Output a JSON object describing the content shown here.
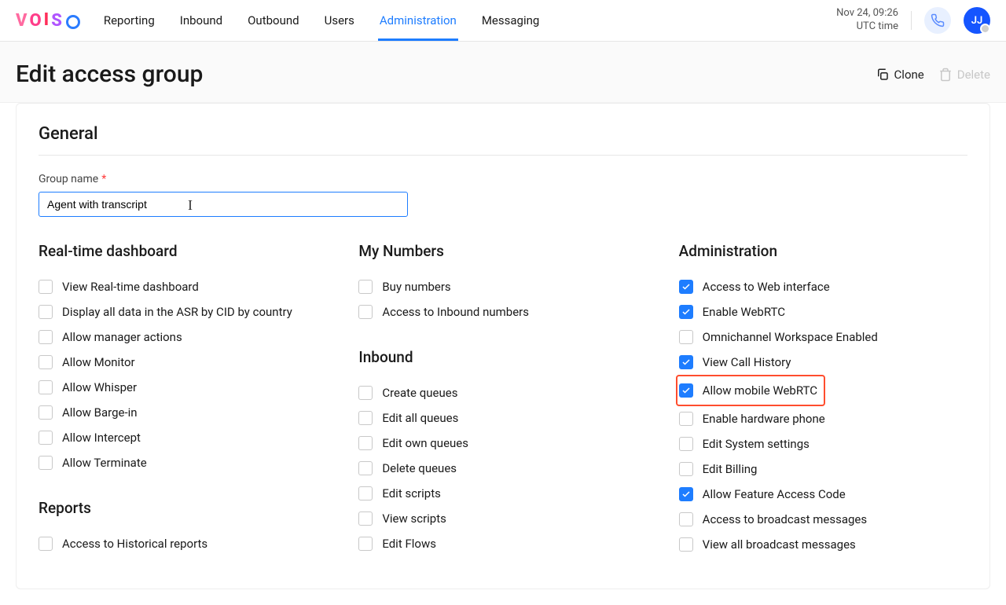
{
  "header": {
    "logo_text": "VOISO",
    "tabs": [
      "Reporting",
      "Inbound",
      "Outbound",
      "Users",
      "Administration",
      "Messaging"
    ],
    "active_tab": 4,
    "datetime": "Nov 24, 09:26",
    "tz": "UTC time",
    "avatar_initials": "JJ"
  },
  "page": {
    "title": "Edit access group",
    "clone": "Clone",
    "delete": "Delete"
  },
  "form": {
    "section_general": "General",
    "group_name_label": "Group name",
    "group_name_value": "Agent with transcript"
  },
  "cols": {
    "rtd": {
      "title": "Real-time dashboard",
      "items": [
        {
          "label": "View Real-time dashboard",
          "on": false
        },
        {
          "label": "Display all data in the ASR by CID by country",
          "on": false
        },
        {
          "label": "Allow manager actions",
          "on": false
        },
        {
          "label": "Allow Monitor",
          "on": false
        },
        {
          "label": "Allow Whisper",
          "on": false
        },
        {
          "label": "Allow Barge-in",
          "on": false
        },
        {
          "label": "Allow Intercept",
          "on": false
        },
        {
          "label": "Allow Terminate",
          "on": false
        }
      ]
    },
    "reports": {
      "title": "Reports",
      "items": [
        {
          "label": "Access to Historical reports",
          "on": false
        }
      ]
    },
    "mynum": {
      "title": "My Numbers",
      "items": [
        {
          "label": "Buy numbers",
          "on": false
        },
        {
          "label": "Access to Inbound numbers",
          "on": false
        }
      ]
    },
    "inbound": {
      "title": "Inbound",
      "items": [
        {
          "label": "Create queues",
          "on": false
        },
        {
          "label": "Edit all queues",
          "on": false
        },
        {
          "label": "Edit own queues",
          "on": false
        },
        {
          "label": "Delete queues",
          "on": false
        },
        {
          "label": "Edit scripts",
          "on": false
        },
        {
          "label": "View scripts",
          "on": false
        },
        {
          "label": "Edit Flows",
          "on": false
        }
      ]
    },
    "admin": {
      "title": "Administration",
      "items": [
        {
          "label": "Access to Web interface",
          "on": true
        },
        {
          "label": "Enable WebRTC",
          "on": true
        },
        {
          "label": "Omnichannel Workspace Enabled",
          "on": false
        },
        {
          "label": "View Call History",
          "on": true
        },
        {
          "label": "Allow mobile WebRTC",
          "on": true,
          "highlight": true
        },
        {
          "label": "Enable hardware phone",
          "on": false
        },
        {
          "label": "Edit System settings",
          "on": false
        },
        {
          "label": "Edit Billing",
          "on": false
        },
        {
          "label": "Allow Feature Access Code",
          "on": true
        },
        {
          "label": "Access to broadcast messages",
          "on": false
        },
        {
          "label": "View all broadcast messages",
          "on": false
        }
      ]
    }
  }
}
